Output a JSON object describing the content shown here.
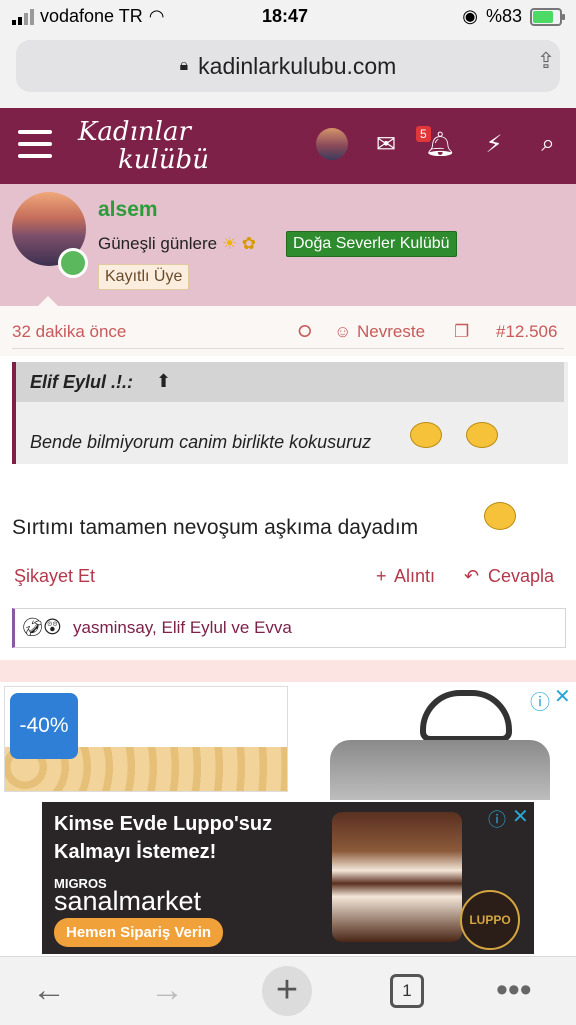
{
  "status": {
    "carrier": "vodafone TR",
    "time": "18:47",
    "battery": "%83"
  },
  "browser": {
    "url": "kadinlarkulubu.com",
    "tab_count": "1"
  },
  "header": {
    "logo_line1": "Kadınlar",
    "logo_line2": "kulübü",
    "notif_count": "5"
  },
  "user": {
    "name": "alsem",
    "title": "Güneşli günlere",
    "club": "Doğa Severler Kulübü",
    "role": "Kayıtlı Üye"
  },
  "post": {
    "time_ago": "32 dakika önce",
    "author_link": "Nevreste",
    "number": "#12.506",
    "quote_author": "Elif Eylul .!.:",
    "quote_text": "Bende bilmiyorum canim birlikte kokusuruz",
    "message": "Sırtımı tamamen nevoşum aşkıma dayadım",
    "report": "Şikayet Et",
    "quote_action": "Alıntı",
    "reply": "Cevapla",
    "reactions": "yasminsay, Elif Eylul ve Evva"
  },
  "ads": {
    "discount": "-40%",
    "banner_line1": "Kimse Evde Luppo'suz",
    "banner_line2": "Kalmayı İstemez!",
    "migros": "MIGROS",
    "sanal": "sanalmarket",
    "cta": "Hemen Sipariş Verin",
    "luppo": "LUPPO"
  },
  "colors": {
    "brand": "#7d2148",
    "user_band": "#e5c1cd",
    "accent_red": "#c75a5a",
    "green": "#2a9d3a"
  }
}
